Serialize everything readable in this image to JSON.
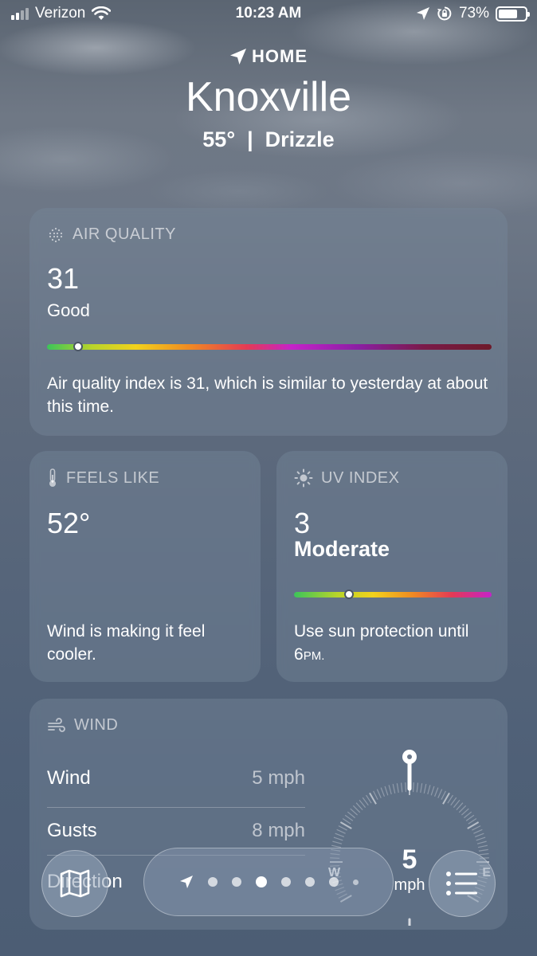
{
  "status_bar": {
    "carrier": "Verizon",
    "time": "10:23 AM",
    "battery": "73%",
    "battery_level": 0.73
  },
  "header": {
    "location_label": "HOME",
    "city": "Knoxville",
    "conditions": "55°  |  Drizzle"
  },
  "air_quality": {
    "title": "AIR QUALITY",
    "value": "31",
    "category": "Good",
    "scale_position": 0.07,
    "description": "Air quality index is 31, which is similar to yesterday at about this time."
  },
  "feels_like": {
    "title": "FEELS LIKE",
    "value": "52°",
    "description": "Wind is making it feel cooler."
  },
  "uv_index": {
    "title": "UV INDEX",
    "value": "3",
    "category": "Moderate",
    "scale_position": 0.28,
    "description_main": "Use sun protection until 6",
    "description_suffix": "PM."
  },
  "wind": {
    "title": "WIND",
    "rows": [
      {
        "label": "Wind",
        "value": "5 mph"
      },
      {
        "label": "Gusts",
        "value": "8 mph"
      },
      {
        "label": "Direction",
        "value": ""
      }
    ],
    "compass": {
      "speed": "5",
      "unit": "mph",
      "west": "W",
      "east": "E"
    }
  },
  "pager": {
    "page_count": 8,
    "active_index": 3
  },
  "icons": {
    "location": "location-arrow-icon",
    "map": "map-icon",
    "list": "list-icon",
    "air_quality": "air-quality-icon",
    "feels_like": "thermometer-icon",
    "uv": "sun-icon",
    "wind": "wind-icon"
  }
}
